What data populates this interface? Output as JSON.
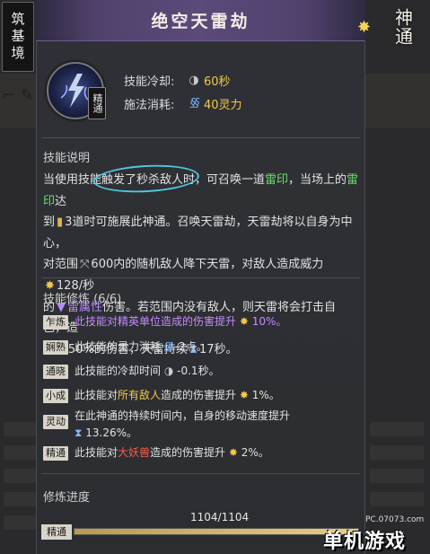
{
  "realm": "筑基境",
  "title": "绝空天雷劫",
  "brand": "神通",
  "skill": {
    "tier": "精通",
    "stats": [
      {
        "label": "技能冷却:",
        "icon": "cooldown-icon",
        "value": "60秒"
      },
      {
        "label": "施法消耗:",
        "icon": "mana-icon",
        "value": "40灵力"
      }
    ]
  },
  "description": {
    "heading": "技能说明",
    "lines": [
      [
        "当使用技能触发了秒杀敌人时，可召唤一道",
        {
          "t": "雷印",
          "c": "green"
        },
        "，当场上的",
        {
          "t": "雷印",
          "c": "green"
        },
        "达"
      ],
      [
        "到",
        {
          "icon": "book-icon",
          "g": "▮"
        },
        "3道时可施展此神通。召唤天雷劫，天雷劫将以自身为中心，"
      ],
      [
        "对范围",
        {
          "icon": "area-icon",
          "g": "⤧"
        },
        "600内的随机敌人降下天雷，对敌人造成威力",
        {
          "icon": "sun-icon",
          "g": "✸"
        },
        "128/秒"
      ],
      [
        "的",
        {
          "icon": "element-icon",
          "g": "▼"
        },
        {
          "t": "雷属性",
          "c": "purple"
        },
        "伤害。若范围内没有敌人，则天雷将会打击自己，造"
      ],
      [
        "成",
        {
          "icon": "sun-icon",
          "g": "✸"
        },
        "50%的伤害，天雷持续",
        {
          "icon": "hourglass-icon",
          "g": "⧗"
        },
        "17秒。"
      ]
    ]
  },
  "cultivation": {
    "heading": "技能修炼 (6/6)",
    "rows": [
      {
        "tag": "乍炼",
        "text": "此技能对精英单位造成的伤害提升",
        "value": "10%。",
        "style": "purple"
      },
      {
        "tag": "娴熟",
        "text": "此技能的灵力消耗",
        "value": "-2点。",
        "style": "mana"
      },
      {
        "tag": "通晓",
        "text": "此技能的冷却时间",
        "value": "-0.1秒。",
        "style": "cd"
      },
      {
        "tag": "小成",
        "text_a": "此技能对",
        "hl": "所有敌人",
        "text_b": "造成的伤害提升",
        "value": "1%。",
        "style": "yellow"
      },
      {
        "tag": "灵动",
        "text": "在此神通的持续时间内，自身的移动速度提升",
        "value": "13.26%。",
        "style": "hourglass"
      },
      {
        "tag": "精通",
        "text_a": "此技能对",
        "hl": "大妖兽",
        "text_b": "造成的伤害提升",
        "value": "2%。",
        "style": "red"
      }
    ]
  },
  "progress": {
    "heading": "修炼进度",
    "label": "精通",
    "text": "1104/1104",
    "fraction": 1.0
  },
  "watermark": {
    "url": "PC.07073.com",
    "brand": "单机游戏"
  }
}
